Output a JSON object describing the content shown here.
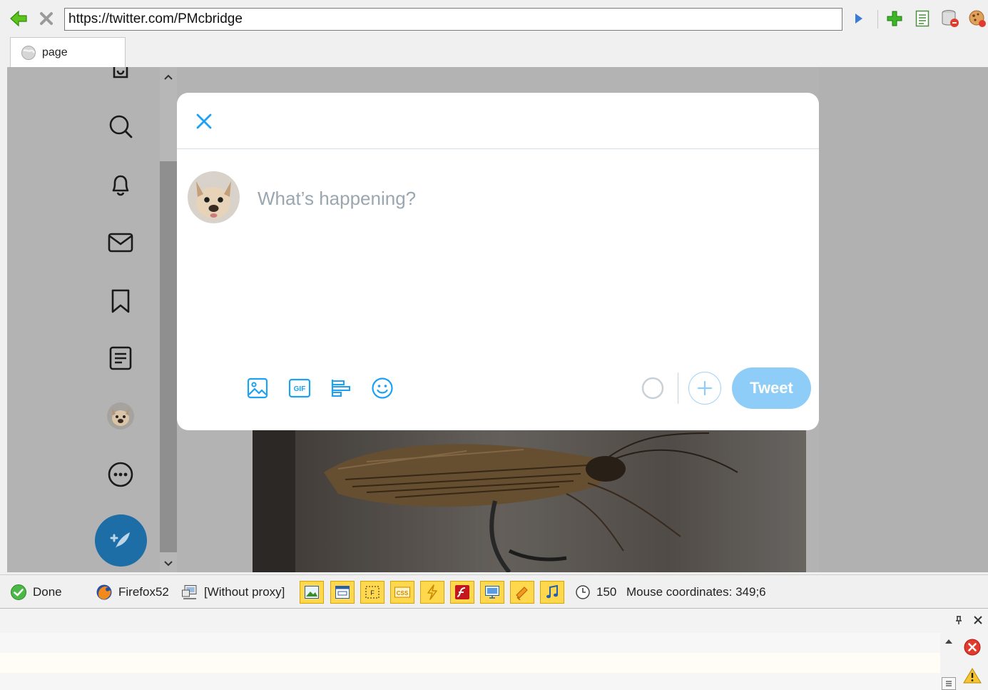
{
  "browser": {
    "url": "https://twitter.com/PMcbridge",
    "tab_label": "page",
    "toolbar_icons": [
      "back-arrow-icon",
      "stop-icon",
      "go-icon",
      "add-icon",
      "page-icon",
      "database-icon",
      "cookie-icon"
    ]
  },
  "twitter_nav": {
    "icons": [
      "bookmark-partial-icon",
      "search-icon",
      "bell-icon",
      "mail-icon",
      "bookmark-icon",
      "list-icon",
      "avatar",
      "more-icon",
      "compose-icon"
    ]
  },
  "composer": {
    "placeholder": "What’s happening?",
    "tweet_label": "Tweet",
    "tools": [
      "image-icon",
      "gif-icon",
      "poll-icon",
      "emoji-icon"
    ],
    "accent": "#1da1f2"
  },
  "statusbar": {
    "status": "Done",
    "browser_name": "Firefox52",
    "proxy": "[Without proxy]",
    "timer": "150",
    "mouse": "Mouse coordinates: 349;6"
  }
}
